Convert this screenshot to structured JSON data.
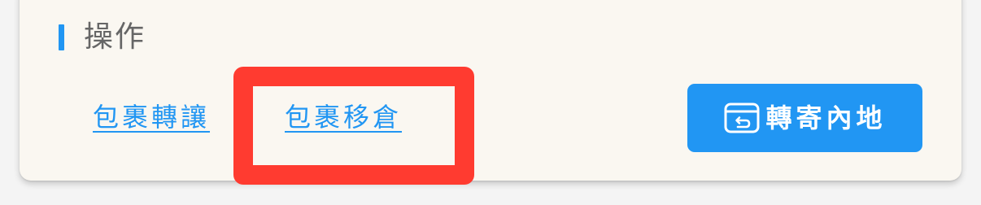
{
  "section": {
    "title": "操作"
  },
  "actions": {
    "transfer_label": "包裹轉讓",
    "move_label": "包裹移倉",
    "forward_label": "轉寄內地",
    "forward_icon": "return-box-icon"
  },
  "colors": {
    "accent": "#2196f3",
    "highlight": "#ff3b30",
    "card_background": "#faf7f1",
    "title_text": "#666666"
  }
}
